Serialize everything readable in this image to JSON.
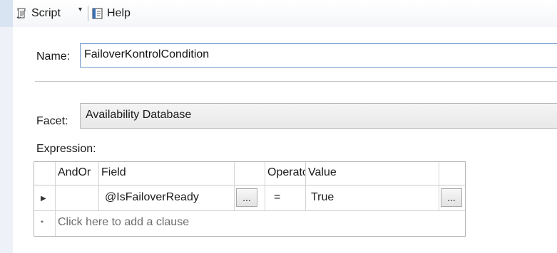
{
  "toolbar": {
    "script_label": "Script",
    "script_dropdown": "▾",
    "help_label": "Help"
  },
  "form": {
    "name_label": "Name:",
    "name_value": "FailoverKontrolCondition",
    "facet_label": "Facet:",
    "facet_value": "Availability Database",
    "expression_label": "Expression:"
  },
  "grid": {
    "columns": [
      "AndOr",
      "Field",
      "",
      "Operator",
      "Value",
      ""
    ],
    "rows": [
      {
        "row_marker": "▶",
        "andor": "",
        "field": "@IsFailoverReady",
        "field_button": "...",
        "operator": "=",
        "value": "True",
        "value_button": "..."
      }
    ],
    "new_row_marker": "*",
    "new_row_placeholder": "Click here to add a clause"
  },
  "colors": {
    "input_border": "#6a96c8",
    "left_strip": "#eef2f8",
    "grid_border": "#b4b4b4"
  },
  "icons": {
    "script": "script-icon",
    "help": "help-icon"
  }
}
